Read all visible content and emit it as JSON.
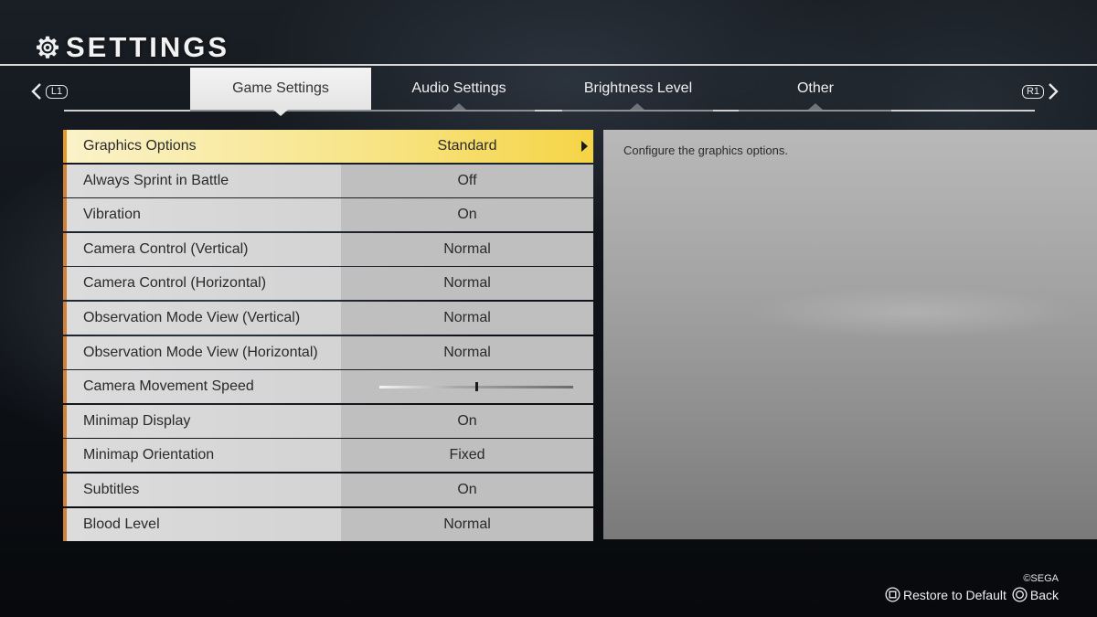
{
  "header": {
    "title": "SETTINGS",
    "icon": "gear-icon"
  },
  "tabs": {
    "left_button": "L1",
    "right_button": "R1",
    "items": [
      {
        "label": "Game Settings",
        "active": true
      },
      {
        "label": "Audio Settings",
        "active": false
      },
      {
        "label": "Brightness Level",
        "active": false
      },
      {
        "label": "Other",
        "active": false
      }
    ]
  },
  "settings": {
    "rows": [
      {
        "label": "Graphics Options",
        "value": "Standard",
        "selected": true,
        "type": "submenu"
      },
      {
        "label": "Always Sprint in Battle",
        "value": "Off",
        "type": "option"
      },
      {
        "label": "Vibration",
        "value": "On",
        "type": "option"
      },
      {
        "label": "Camera Control (Vertical)",
        "value": "Normal",
        "type": "option"
      },
      {
        "label": "Camera Control (Horizontal)",
        "value": "Normal",
        "type": "option"
      },
      {
        "label": "Observation Mode View (Vertical)",
        "value": "Normal",
        "type": "option"
      },
      {
        "label": "Observation Mode View (Horizontal)",
        "value": "Normal",
        "type": "option"
      },
      {
        "label": "Camera Movement Speed",
        "type": "slider",
        "slider_level": 0.5
      },
      {
        "label": "Minimap Display",
        "value": "On",
        "type": "option"
      },
      {
        "label": "Minimap Orientation",
        "value": "Fixed",
        "type": "option"
      },
      {
        "label": "Subtitles",
        "value": "On",
        "type": "option"
      },
      {
        "label": "Blood Level",
        "value": "Normal",
        "type": "option"
      }
    ]
  },
  "description": {
    "text": "Configure the graphics options."
  },
  "footer": {
    "copyright": "©SEGA",
    "hints": [
      {
        "icon": "square-button-icon",
        "label": "Restore to Default"
      },
      {
        "icon": "circle-button-icon",
        "label": "Back"
      }
    ]
  },
  "colors": {
    "accent": "#d0813a",
    "selected_row": "#f8e58a"
  }
}
